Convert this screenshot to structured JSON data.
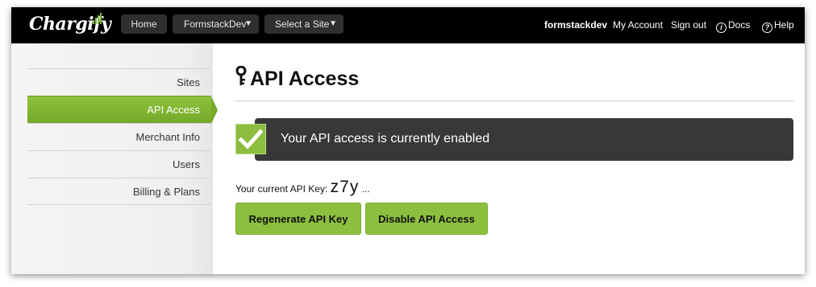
{
  "app": {
    "logo_text": "Chargify"
  },
  "topnav": {
    "home": "Home",
    "account_select": "FormstackDev",
    "site_select": "Select a Site",
    "username": "formstackdev",
    "my_account": "My Account",
    "sign_out": "Sign out",
    "docs": "Docs",
    "help": "Help"
  },
  "sidebar": {
    "items": [
      {
        "label": "Sites",
        "active": false
      },
      {
        "label": "API Access",
        "active": true
      },
      {
        "label": "Merchant Info",
        "active": false
      },
      {
        "label": "Users",
        "active": false
      },
      {
        "label": "Billing & Plans",
        "active": false
      }
    ]
  },
  "main": {
    "title": "API Access",
    "notice": "Your API access is currently enabled",
    "api_key_label": "Your current API Key:",
    "api_key_value": "z7y",
    "api_key_ellipsis": "...",
    "regenerate_button": "Regenerate API Key",
    "disable_button": "Disable API Access"
  },
  "colors": {
    "brand_green": "#8cbf3f",
    "topbar": "#000000",
    "notice_bg": "#383838"
  },
  "icons": [
    "key-icon",
    "checkmark-icon",
    "info-icon",
    "help-icon",
    "chevron-down-icon"
  ]
}
